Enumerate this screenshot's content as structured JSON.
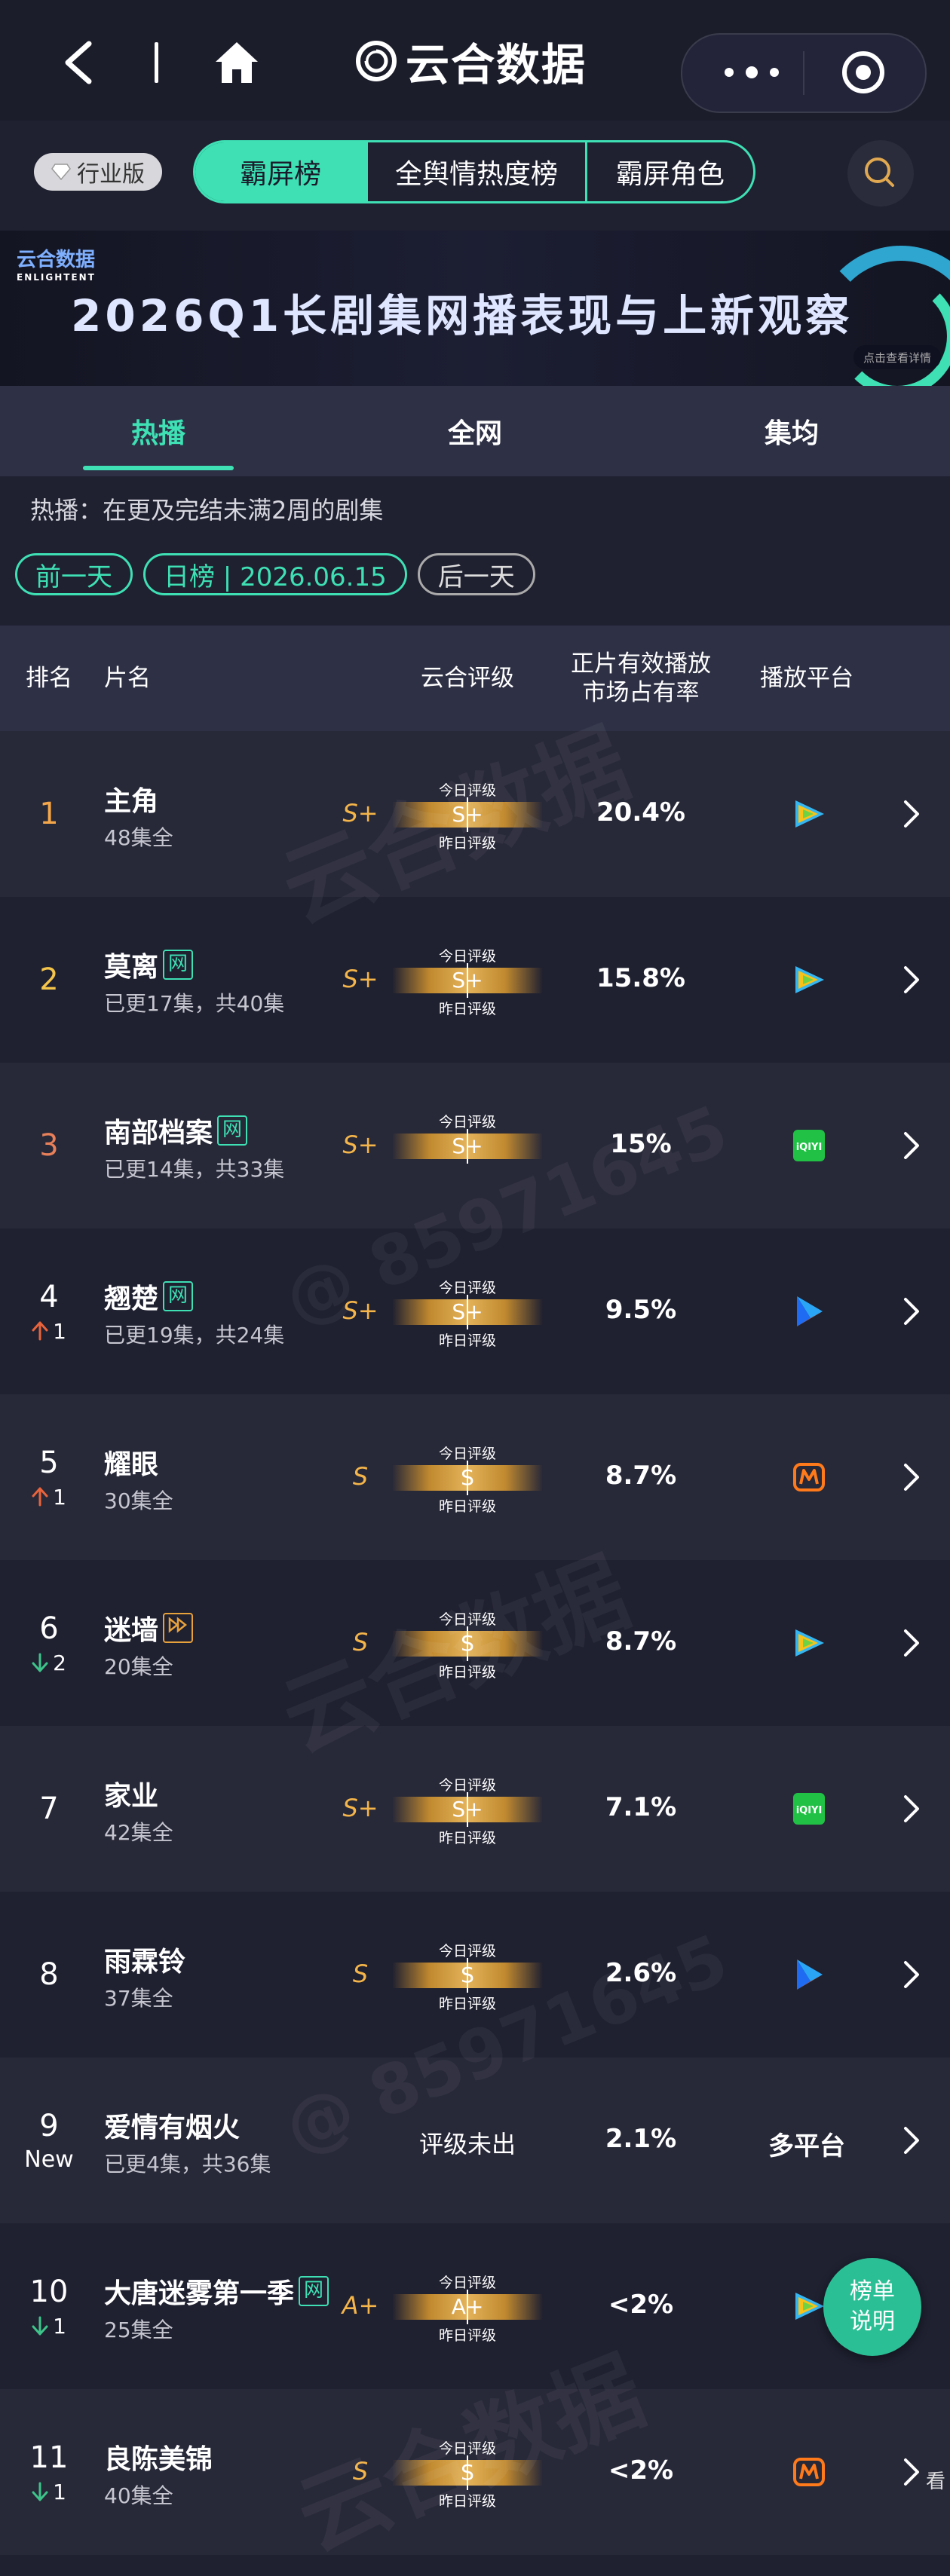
{
  "header": {
    "brand": "云合数据"
  },
  "toolbar": {
    "industry": "行业版",
    "segments": [
      "霸屏榜",
      "全舆情热度榜",
      "霸屏角色"
    ]
  },
  "banner": {
    "logo": "云合数据",
    "logo_sub": "ENLIGHTENT",
    "title": "2026Q1长剧集网播表现与上新观察",
    "cta": "点击查看详情"
  },
  "tabs": [
    "热播",
    "全网",
    "集均"
  ],
  "description": "热播：在更及完结未满2周的剧集",
  "date_nav": {
    "prev": "前一天",
    "current": "日榜 | 2026.06.15",
    "next": "后一天"
  },
  "columns": {
    "rank": "排名",
    "title": "片名",
    "rating": "云合评级",
    "share_line1": "正片有效播放",
    "share_line2": "市场占有率",
    "platform": "播放平台"
  },
  "grade_labels": {
    "today": "今日评级",
    "yesterday": "昨日评级"
  },
  "rows": [
    {
      "rank": "1",
      "trend": "",
      "title": "主角",
      "tag": "",
      "eps": "48集全",
      "grade_prev": "S+",
      "grade_today": "S+",
      "share": "20.4%",
      "platform_icon": "tencent-video-icon",
      "platform_text": ""
    },
    {
      "rank": "2",
      "trend": "",
      "title": "莫离",
      "tag": "网",
      "eps": "已更17集，共40集",
      "grade_prev": "S+",
      "grade_today": "S+",
      "share": "15.8%",
      "platform_icon": "tencent-video-icon",
      "platform_text": ""
    },
    {
      "rank": "3",
      "trend": "",
      "title": "南部档案",
      "tag": "网",
      "eps": "已更14集，共33集",
      "grade_prev": "S+",
      "grade_today": "S+",
      "share": "15%",
      "platform_icon": "iqiyi-icon",
      "platform_text": ""
    },
    {
      "rank": "4",
      "trend": "1",
      "trend_dir": "up",
      "title": "翘楚",
      "tag": "网",
      "eps": "已更19集，共24集",
      "grade_prev": "S+",
      "grade_today": "S+",
      "share": "9.5%",
      "platform_icon": "youku-icon",
      "platform_text": ""
    },
    {
      "rank": "5",
      "trend": "1",
      "trend_dir": "up",
      "title": "耀眼",
      "tag": "",
      "eps": "30集全",
      "grade_prev": "S",
      "grade_today": "S",
      "share": "8.7%",
      "platform_icon": "mango-tv-icon",
      "platform_text": ""
    },
    {
      "rank": "6",
      "trend": "2",
      "trend_dir": "down",
      "title": "迷墙",
      "tag": "vip",
      "eps": "20集全",
      "grade_prev": "S",
      "grade_today": "S",
      "share": "8.7%",
      "platform_icon": "tencent-video-icon",
      "platform_text": ""
    },
    {
      "rank": "7",
      "trend": "",
      "title": "家业",
      "tag": "",
      "eps": "42集全",
      "grade_prev": "S+",
      "grade_today": "S+",
      "share": "7.1%",
      "platform_icon": "iqiyi-icon",
      "platform_text": ""
    },
    {
      "rank": "8",
      "trend": "",
      "title": "雨霖铃",
      "tag": "",
      "eps": "37集全",
      "grade_prev": "S",
      "grade_today": "S",
      "share": "2.6%",
      "platform_icon": "youku-icon",
      "platform_text": ""
    },
    {
      "rank": "9",
      "trend": "New",
      "trend_dir": "new",
      "title": "爱情有烟火",
      "tag": "",
      "eps": "已更4集，共36集",
      "grade_prev": "",
      "grade_today": "",
      "grade_none": "评级未出",
      "share": "2.1%",
      "platform_icon": "",
      "platform_text": "多平台"
    },
    {
      "rank": "10",
      "trend": "1",
      "trend_dir": "down",
      "title": "大唐迷雾第一季",
      "tag": "网",
      "eps": "25集全",
      "grade_prev": "A+",
      "grade_today": "A+",
      "share": "<2%",
      "platform_icon": "tencent-video-icon",
      "platform_text": ""
    },
    {
      "rank": "11",
      "trend": "1",
      "trend_dir": "down",
      "title": "良陈美锦",
      "tag": "",
      "eps": "40集全",
      "grade_prev": "S",
      "grade_today": "S",
      "share": "<2%",
      "platform_icon": "mango-tv-icon",
      "platform_text": ""
    }
  ],
  "fab": {
    "line1": "榜单",
    "line2": "说明"
  },
  "watermark": {
    "brand": "云合数据",
    "brand_en": "ENLIGHTENT",
    "number": "@ 85971645"
  },
  "colors": {
    "accent": "#3ee0b4",
    "grade_gold": "#f4b54a",
    "up": "#e8643c",
    "down": "#3ec48a"
  }
}
